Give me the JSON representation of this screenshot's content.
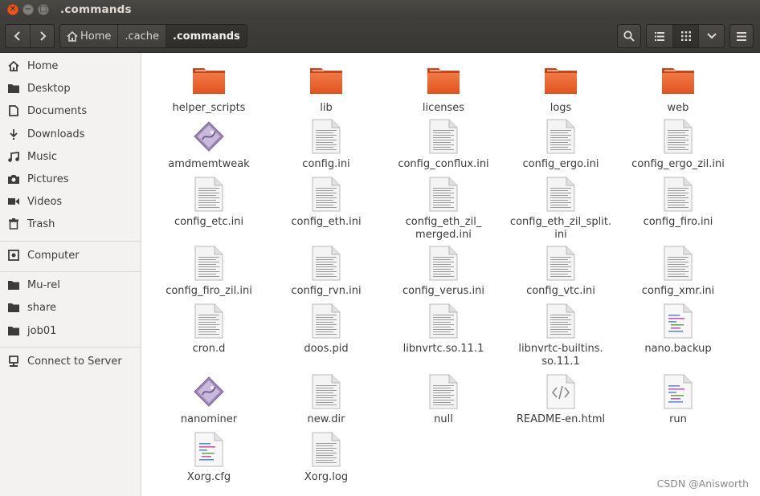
{
  "window": {
    "title": ".commands"
  },
  "toolbar": {
    "breadcrumbs": [
      "Home",
      ".cache",
      ".commands"
    ]
  },
  "sidebar": {
    "items": [
      {
        "label": "Home",
        "icon": "home-icon"
      },
      {
        "label": "Desktop",
        "icon": "folder-icon"
      },
      {
        "label": "Documents",
        "icon": "document-icon"
      },
      {
        "label": "Downloads",
        "icon": "download-icon"
      },
      {
        "label": "Music",
        "icon": "music-icon"
      },
      {
        "label": "Pictures",
        "icon": "camera-icon"
      },
      {
        "label": "Videos",
        "icon": "video-icon"
      },
      {
        "label": "Trash",
        "icon": "trash-icon"
      },
      {
        "label": "Computer",
        "icon": "drive-icon"
      },
      {
        "label": "Mu-rel",
        "icon": "folder-icon"
      },
      {
        "label": "share",
        "icon": "folder-icon"
      },
      {
        "label": "job01",
        "icon": "folder-icon"
      },
      {
        "label": "Connect to Server",
        "icon": "server-icon"
      }
    ]
  },
  "files": [
    {
      "name": "helper_scripts",
      "type": "folder"
    },
    {
      "name": "lib",
      "type": "folder"
    },
    {
      "name": "licenses",
      "type": "folder"
    },
    {
      "name": "logs",
      "type": "folder"
    },
    {
      "name": "web",
      "type": "folder"
    },
    {
      "name": "amdmemtweak",
      "type": "executable"
    },
    {
      "name": "config.ini",
      "type": "text"
    },
    {
      "name": "config_conflux.ini",
      "type": "text"
    },
    {
      "name": "config_ergo.ini",
      "type": "text"
    },
    {
      "name": "config_ergo_zil.ini",
      "type": "text"
    },
    {
      "name": "config_etc.ini",
      "type": "text"
    },
    {
      "name": "config_eth.ini",
      "type": "text"
    },
    {
      "name": "config_eth_zil_\nmerged.ini",
      "type": "text"
    },
    {
      "name": "config_eth_zil_split.\nini",
      "type": "text"
    },
    {
      "name": "config_firo.ini",
      "type": "text"
    },
    {
      "name": "config_firo_zil.ini",
      "type": "text"
    },
    {
      "name": "config_rvn.ini",
      "type": "text"
    },
    {
      "name": "config_verus.ini",
      "type": "text"
    },
    {
      "name": "config_vtc.ini",
      "type": "text"
    },
    {
      "name": "config_xmr.ini",
      "type": "text"
    },
    {
      "name": "cron.d",
      "type": "text"
    },
    {
      "name": "doos.pid",
      "type": "text"
    },
    {
      "name": "libnvrtc.so.11.1",
      "type": "text"
    },
    {
      "name": "libnvrtc-builtins.\nso.11.1",
      "type": "text"
    },
    {
      "name": "nano.backup",
      "type": "script"
    },
    {
      "name": "nanominer",
      "type": "executable"
    },
    {
      "name": "new.dir",
      "type": "text"
    },
    {
      "name": "null",
      "type": "text"
    },
    {
      "name": "README-en.html",
      "type": "html"
    },
    {
      "name": "run",
      "type": "script"
    },
    {
      "name": "Xorg.cfg",
      "type": "script"
    },
    {
      "name": "Xorg.log",
      "type": "text"
    }
  ],
  "watermark": "CSDN @Anisworth",
  "colors": {
    "folder": "#e95420",
    "accent": "#e95420"
  }
}
